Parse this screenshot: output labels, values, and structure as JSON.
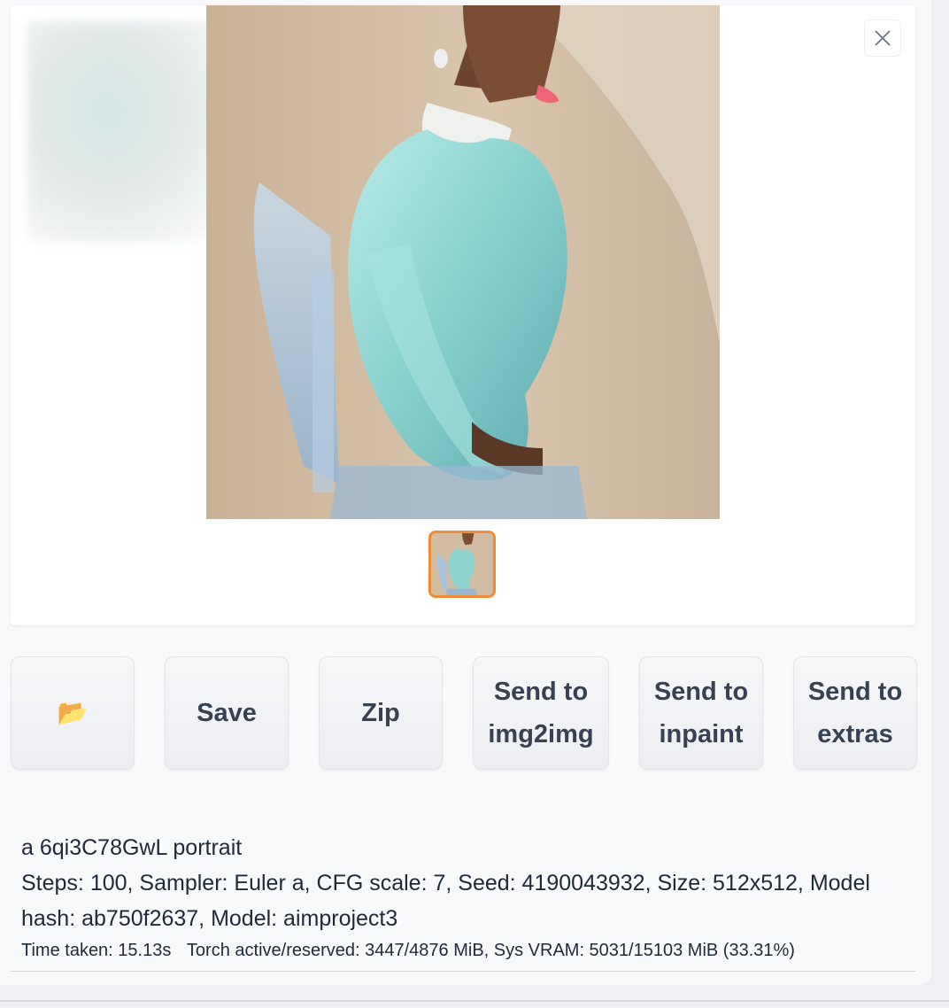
{
  "gallery": {
    "close_icon": "close-icon",
    "image_alt": "generated portrait"
  },
  "actions": {
    "folder_icon": "📂",
    "save_label": "Save",
    "zip_label": "Zip",
    "img2img_line1": "Send to",
    "img2img_line2": "img2img",
    "inpaint_line1": "Send to",
    "inpaint_line2": "inpaint",
    "extras_line1": "Send to",
    "extras_line2": "extras"
  },
  "info": {
    "prompt": "a 6qi3C78GwL portrait",
    "params": "Steps: 100, Sampler: Euler a, CFG scale: 7, Seed: 4190043932, Size: 512x512, Model hash: ab750f2637, Model: aimproject3"
  },
  "perf": {
    "time_taken": "Time taken: 15.13s",
    "torch": "Torch active/reserved: 3447/4876 MiB, Sys VRAM: 5031/15103 MiB (33.31%)"
  },
  "colors": {
    "thumb_border": "#f08a35",
    "sweater": "#8fd3cf",
    "background": "#d8c3a8"
  }
}
